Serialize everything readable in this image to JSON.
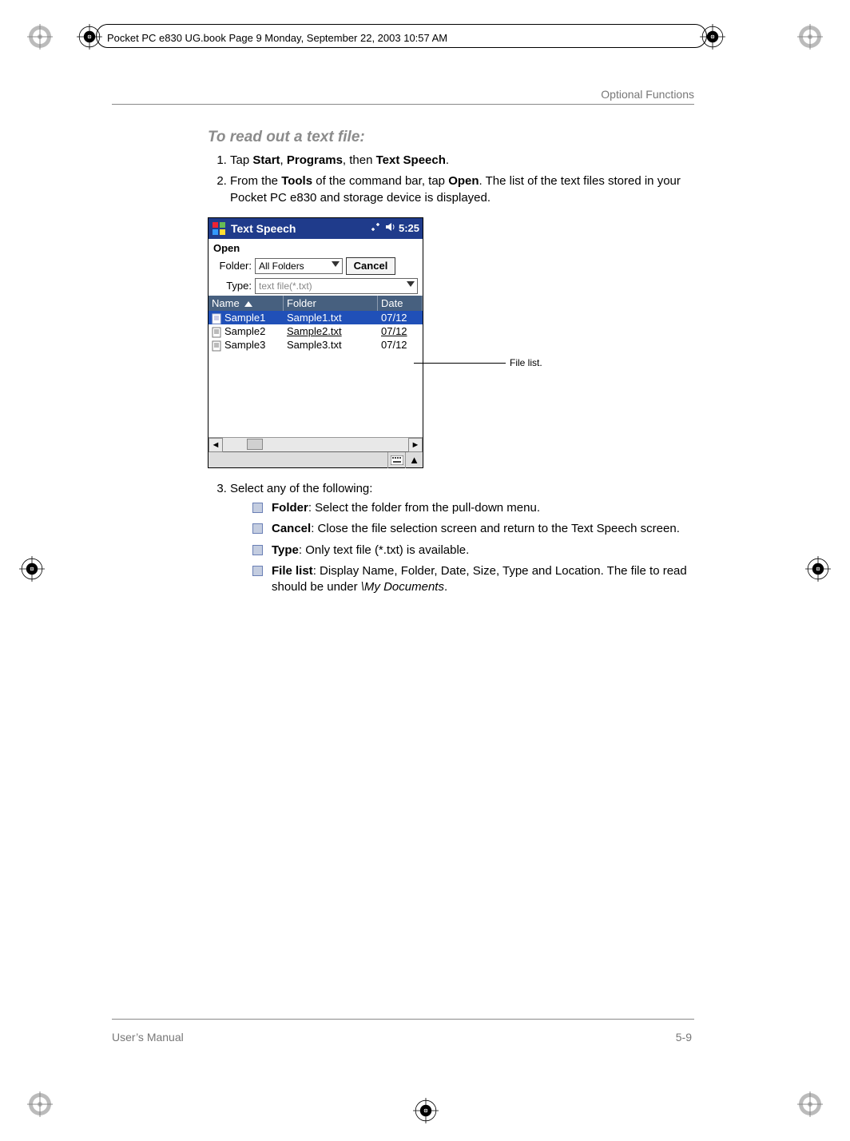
{
  "meta": {
    "header_stamp": "Pocket PC e830 UG.book  Page 9  Monday, September 22, 2003  10:57 AM",
    "section_title": "Optional Functions"
  },
  "heading": "To read out a text file:",
  "steps": {
    "s1_pre": "Tap ",
    "s1_b1": "Start",
    "s1_sep1": ", ",
    "s1_b2": "Programs",
    "s1_sep2": ", then ",
    "s1_b3": "Text Speech",
    "s1_end": ".",
    "s2_pre": "From the ",
    "s2_b1": "Tools",
    "s2_mid1": " of the command bar, tap ",
    "s2_b2": "Open",
    "s2_end": ". The list of the text files stored in your Pocket PC e830 and storage device is displayed.",
    "s3": "Select any of the following:"
  },
  "pda": {
    "title": "Text Speech",
    "clock": "5:25",
    "open_label": "Open",
    "folder_label": "Folder:",
    "folder_value": "All Folders",
    "type_label": "Type:",
    "type_value": "text file(*.txt)",
    "cancel": "Cancel",
    "columns": {
      "name": "Name",
      "folder": "Folder",
      "date": "Date"
    },
    "rows": [
      {
        "name": "Sample1",
        "folder": "Sample1.txt",
        "date": "07/12"
      },
      {
        "name": "Sample2",
        "folder": "Sample2.txt",
        "date": "07/12"
      },
      {
        "name": "Sample3",
        "folder": "Sample3.txt",
        "date": "07/12"
      }
    ]
  },
  "callout": "File list.",
  "bullets": {
    "b1_bold": "Folder",
    "b1_text": ": Select the folder from the pull-down menu.",
    "b2_bold": "Cancel",
    "b2_text": ": Close the file selection screen and return to the Text Speech screen.",
    "b3_bold": "Type",
    "b3_text": ": Only text file (*.txt) is available.",
    "b4_bold": "File list",
    "b4_text_a": ": Display Name, Folder, Date, Size, Type and Location. The file to read should be under ",
    "b4_italic": "\\My Documents",
    "b4_text_b": "."
  },
  "footer": {
    "left": "User’s Manual",
    "right": "5-9"
  }
}
